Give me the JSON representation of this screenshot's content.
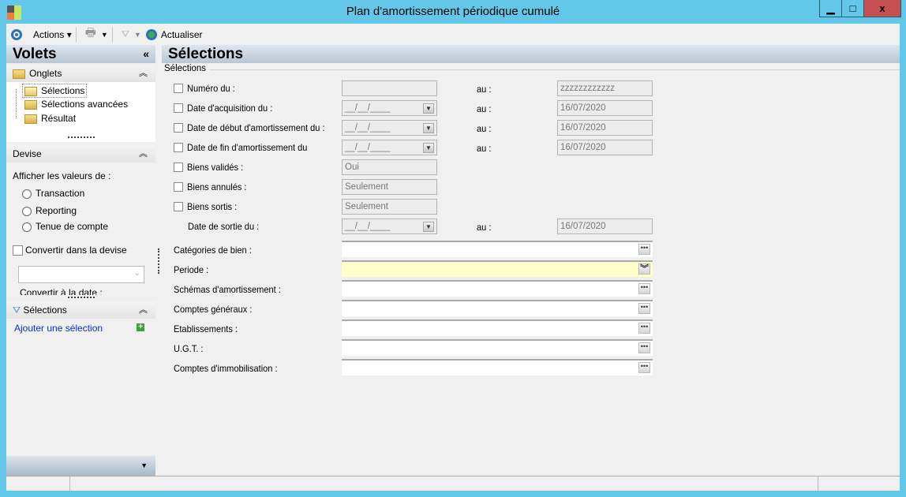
{
  "window": {
    "title": "Plan d'amortissement périodique cumulé",
    "minimize": "▁",
    "maximize": "□",
    "close": "x"
  },
  "toolbar": {
    "actions": "Actions",
    "refresh": "Actualiser"
  },
  "left": {
    "title": "Volets",
    "collapse": "«",
    "onglets": {
      "title": "Onglets",
      "items": [
        "Sélections",
        "Sélections avancées",
        "Résultat"
      ]
    },
    "devise": {
      "title": "Devise",
      "show_label": "Afficher les valeurs de :",
      "options": [
        "Transaction",
        "Reporting",
        "Tenue de compte"
      ],
      "convert": "Convertir dans la devise",
      "convert_date": "Convertir à la date :"
    },
    "selections": {
      "title": "Sélections",
      "add": "Ajouter une sélection"
    }
  },
  "main": {
    "title": "Sélections",
    "group": "Sélections",
    "au": "au :",
    "rows": [
      {
        "label": "Numéro du :",
        "from": "",
        "to": "zzzzzzzzzzzz"
      },
      {
        "label": "Date d'acquisition du :",
        "from": "__/__/____",
        "to": "16/07/2020"
      },
      {
        "label": "Date de début d'amortissement du :",
        "from": "__/__/____",
        "to": "16/07/2020"
      },
      {
        "label": "Date de fin d'amortissement du",
        "from": "__/__/____",
        "to": "16/07/2020"
      },
      {
        "label": "Biens validés :",
        "value": "Oui"
      },
      {
        "label": "Biens annulés :",
        "value": "Seulement"
      },
      {
        "label": "Biens sortis :",
        "value": "Seulement"
      },
      {
        "label": "Date de sortie du :",
        "from": "__/__/____",
        "to": "16/07/2020"
      }
    ],
    "lookups": [
      "Catégories de bien :",
      "Periode :",
      "Schémas d'amortissement :",
      "Comptes généraux :",
      "Etablissements :",
      "U.G.T. :",
      "Comptes d'immobilisation :"
    ]
  },
  "colors": {
    "frame": "#62c7e9",
    "periode_bg": "#ffffc8",
    "link": "#0033cc"
  }
}
